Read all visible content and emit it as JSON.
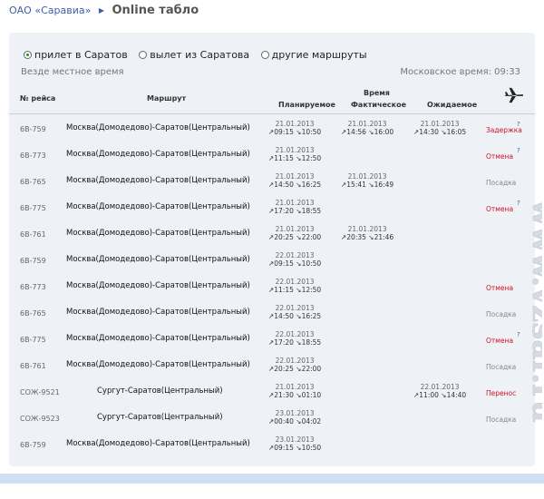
{
  "breadcrumb": {
    "company": "ОАО «Саравиа»",
    "title": "Online табло"
  },
  "tabs": [
    {
      "label": "прилет в Саратов",
      "selected": true
    },
    {
      "label": "вылет из Саратова",
      "selected": false
    },
    {
      "label": "другие маршруты",
      "selected": false
    }
  ],
  "note_local": "Везде местное время",
  "moscow_time": "Московское время:  09:33",
  "headers": {
    "flight": "№ рейса",
    "route": "Маршрут",
    "time": "Время",
    "planned": "Планируемое",
    "actual": "Фактическое",
    "expected": "Ожидаемое"
  },
  "colors": {
    "delay": "#d0102a",
    "cancel": "#d0102a",
    "landing": "#888888",
    "link": "#3a5fa8"
  },
  "rows": [
    {
      "flight": "6В-759",
      "route": "Москва(Домодедово)-Саратов(Центральный)",
      "planned": {
        "date": "21.01.2013",
        "times": "↗09:15  ↘10:50"
      },
      "actual": {
        "date": "21.01.2013",
        "times": "↗14:56  ↘16:00"
      },
      "expected": {
        "date": "21.01.2013",
        "times": "↗14:30  ↘16:05"
      },
      "status": "Задержка",
      "status_color": "#d0102a",
      "help": "?"
    },
    {
      "flight": "6В-773",
      "route": "Москва(Домодедово)-Саратов(Центральный)",
      "planned": {
        "date": "21.01.2013",
        "times": "↗11:15  ↘12:50"
      },
      "actual": {
        "date": "",
        "times": ""
      },
      "expected": {
        "date": "",
        "times": ""
      },
      "status": "Отмена",
      "status_color": "#d0102a",
      "help": "?"
    },
    {
      "flight": "6В-765",
      "route": "Москва(Домодедово)-Саратов(Центральный)",
      "planned": {
        "date": "21.01.2013",
        "times": "↗14:50  ↘16:25"
      },
      "actual": {
        "date": "21.01.2013",
        "times": "↗15:41  ↘16:49"
      },
      "expected": {
        "date": "",
        "times": ""
      },
      "status": "Посадка",
      "status_color": "#888888",
      "help": ""
    },
    {
      "flight": "6В-775",
      "route": "Москва(Домодедово)-Саратов(Центральный)",
      "planned": {
        "date": "21.01.2013",
        "times": "↗17:20  ↘18:55"
      },
      "actual": {
        "date": "",
        "times": ""
      },
      "expected": {
        "date": "",
        "times": ""
      },
      "status": "Отмена",
      "status_color": "#d0102a",
      "help": "?"
    },
    {
      "flight": "6В-761",
      "route": "Москва(Домодедово)-Саратов(Центральный)",
      "planned": {
        "date": "21.01.2013",
        "times": "↗20:25  ↘22:00"
      },
      "actual": {
        "date": "21.01.2013",
        "times": "↗20:35  ↘21:46"
      },
      "expected": {
        "date": "",
        "times": ""
      },
      "status": "",
      "status_color": "#888888",
      "help": ""
    },
    {
      "flight": "6В-759",
      "route": "Москва(Домодедово)-Саратов(Центральный)",
      "planned": {
        "date": "22.01.2013",
        "times": "↗09:15  ↘10:50"
      },
      "actual": {
        "date": "",
        "times": ""
      },
      "expected": {
        "date": "",
        "times": ""
      },
      "status": "",
      "status_color": "#888888",
      "help": ""
    },
    {
      "flight": "6В-773",
      "route": "Москва(Домодедово)-Саратов(Центральный)",
      "planned": {
        "date": "22.01.2013",
        "times": "↗11:15  ↘12:50"
      },
      "actual": {
        "date": "",
        "times": ""
      },
      "expected": {
        "date": "",
        "times": ""
      },
      "status": "Отмена",
      "status_color": "#d0102a",
      "help": ""
    },
    {
      "flight": "6В-765",
      "route": "Москва(Домодедово)-Саратов(Центральный)",
      "planned": {
        "date": "22.01.2013",
        "times": "↗14:50  ↘16:25"
      },
      "actual": {
        "date": "",
        "times": ""
      },
      "expected": {
        "date": "",
        "times": ""
      },
      "status": "Посадка",
      "status_color": "#888888",
      "help": ""
    },
    {
      "flight": "6В-775",
      "route": "Москва(Домодедово)-Саратов(Центральный)",
      "planned": {
        "date": "22.01.2013",
        "times": "↗17:20  ↘18:55"
      },
      "actual": {
        "date": "",
        "times": ""
      },
      "expected": {
        "date": "",
        "times": ""
      },
      "status": "Отмена",
      "status_color": "#d0102a",
      "help": "?"
    },
    {
      "flight": "6В-761",
      "route": "Москва(Домодедово)-Саратов(Центральный)",
      "planned": {
        "date": "22.01.2013",
        "times": "↗20:25  ↘22:00"
      },
      "actual": {
        "date": "",
        "times": ""
      },
      "expected": {
        "date": "",
        "times": ""
      },
      "status": "Посадка",
      "status_color": "#888888",
      "help": ""
    },
    {
      "flight": "СОЖ-9521",
      "route": "Сургут-Саратов(Центральный)",
      "planned": {
        "date": "21.01.2013",
        "times": "↗21:30  ↘01:10"
      },
      "actual": {
        "date": "",
        "times": ""
      },
      "expected": {
        "date": "22.01.2013",
        "times": "↗11:00  ↘14:40"
      },
      "status": "Перенос",
      "status_color": "#d0102a",
      "help": ""
    },
    {
      "flight": "СОЖ-9523",
      "route": "Сургут-Саратов(Центральный)",
      "planned": {
        "date": "23.01.2013",
        "times": "↗00:40  ↘04:02"
      },
      "actual": {
        "date": "",
        "times": ""
      },
      "expected": {
        "date": "",
        "times": ""
      },
      "status": "Посадка",
      "status_color": "#888888",
      "help": ""
    },
    {
      "flight": "6В-759",
      "route": "Москва(Домодедово)-Саратов(Центральный)",
      "planned": {
        "date": "23.01.2013",
        "times": "↗09:15  ↘10:50"
      },
      "actual": {
        "date": "",
        "times": ""
      },
      "expected": {
        "date": "",
        "times": ""
      },
      "status": "",
      "status_color": "#888888",
      "help": ""
    }
  ],
  "watermark": "www.vzsar.ru"
}
